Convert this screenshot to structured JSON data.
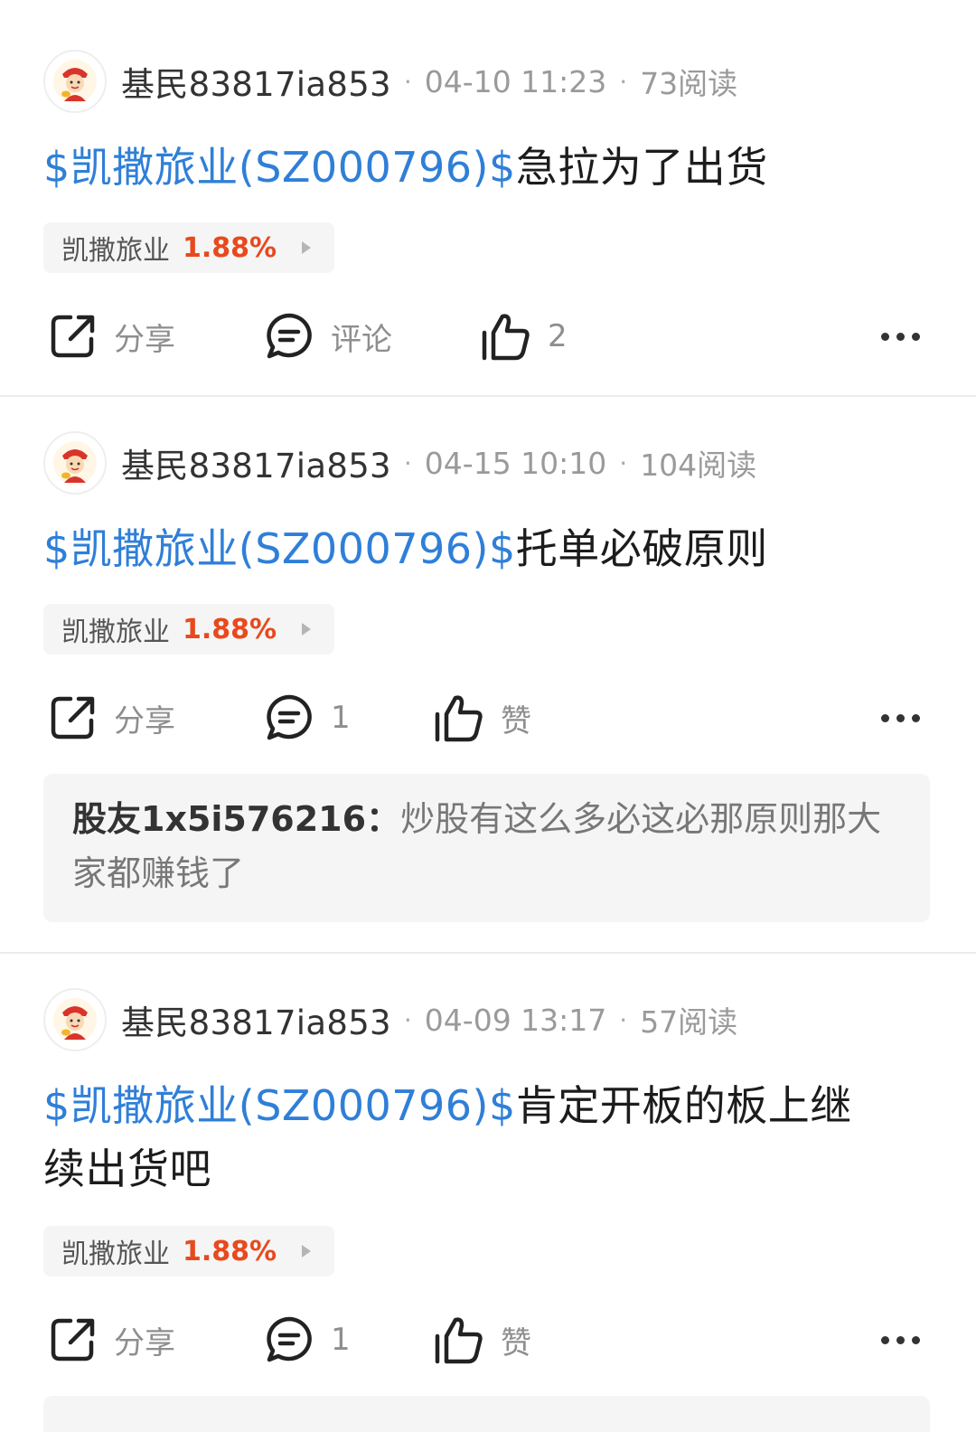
{
  "posts": [
    {
      "author": "基民83817ia853",
      "separator": "·",
      "date": "04-10 11:23",
      "reads": "73阅读",
      "stock_link": "$凯撒旅业(SZ000796)$",
      "body": "急拉为了出货",
      "body_line2": "",
      "tag": {
        "name": "凯撒旅业",
        "change": "1.88%"
      },
      "actions": {
        "share": "分享",
        "comment": "评论",
        "like": "2"
      }
    },
    {
      "author": "基民83817ia853",
      "separator": "·",
      "date": "04-15 10:10",
      "reads": "104阅读",
      "stock_link": "$凯撒旅业(SZ000796)$",
      "body": "托单必破原则",
      "body_line2": "",
      "tag": {
        "name": "凯撒旅业",
        "change": "1.88%"
      },
      "actions": {
        "share": "分享",
        "comment": "1",
        "like": "赞"
      },
      "top_comment": {
        "author": "股友1x5i576216：",
        "text": "炒股有这么多必这必那原则那大家都赚钱了"
      }
    },
    {
      "author": "基民83817ia853",
      "separator": "·",
      "date": "04-09 13:17",
      "reads": "57阅读",
      "stock_link": "$凯撒旅业(SZ000796)$",
      "body": "肯定开板的板上继",
      "body_line2": "续出货吧",
      "tag": {
        "name": "凯撒旅业",
        "change": "1.88%"
      },
      "actions": {
        "share": "分享",
        "comment": "1",
        "like": "赞"
      }
    }
  ],
  "colors": {
    "link": "#2f7fd8",
    "rise": "#e8491d",
    "meta": "#9a9a9a"
  },
  "icons": {
    "share": "share-icon",
    "comment": "comment-icon",
    "like": "thumbs-up-icon",
    "more": "more-icon"
  }
}
